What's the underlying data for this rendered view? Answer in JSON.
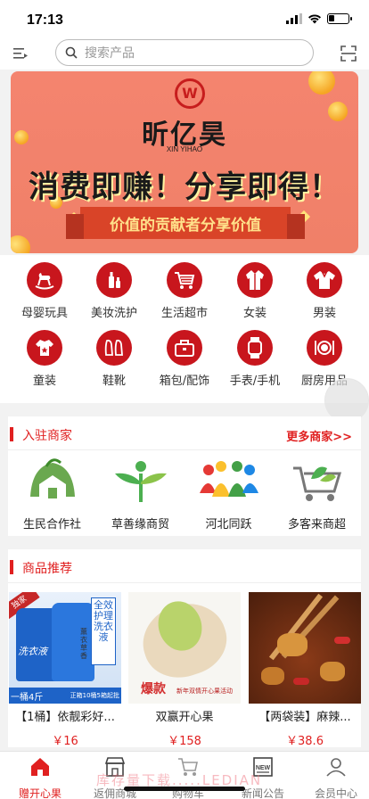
{
  "status_bar": {
    "time": "17:13",
    "battery_level": 0.3
  },
  "search": {
    "placeholder": "搜索产品"
  },
  "banner": {
    "brand_cn": "昕亿昊",
    "brand_en": "XIN YIHAO",
    "slogan": "消费即赚！分享即得！",
    "ribbon_text": "价值的贡献者分享价值"
  },
  "categories": [
    {
      "label": "母婴玩具",
      "icon": "rocking-horse-icon"
    },
    {
      "label": "美妆洗护",
      "icon": "cosmetics-icon"
    },
    {
      "label": "生活超市",
      "icon": "shopping-cart-icon"
    },
    {
      "label": "女装",
      "icon": "coat-icon"
    },
    {
      "label": "男装",
      "icon": "shirt-icon"
    },
    {
      "label": "童装",
      "icon": "kids-shirt-icon"
    },
    {
      "label": "鞋靴",
      "icon": "shoes-icon"
    },
    {
      "label": "箱包/配饰",
      "icon": "bag-icon"
    },
    {
      "label": "手表/手机",
      "icon": "watch-icon"
    },
    {
      "label": "厨房用品",
      "icon": "dish-icon"
    }
  ],
  "merchants": {
    "title": "入驻商家",
    "more": "更多商家>>",
    "items": [
      {
        "name": "生民合作社"
      },
      {
        "name": "草善缘商贸"
      },
      {
        "name": "河北同跃"
      },
      {
        "name": "多客来商超"
      }
    ]
  },
  "products": {
    "title": "商品推荐",
    "items": [
      {
        "name": "【1桶】依靓彩好...",
        "price": "￥16",
        "image_tag": "独家",
        "image_caption_left": "一桶4斤",
        "image_caption_right": "正箱10桶5箱起批",
        "image_side_text": "全效护理洗衣液",
        "image_side_sub": "薰衣草香",
        "bottle_label": "洗衣液"
      },
      {
        "name": "双赢开心果",
        "price": "￥158",
        "image_badge": "爆款",
        "image_promo": "新年双情开心果活动"
      },
      {
        "name": "【两袋装】麻辣...",
        "price": "￥38.6"
      }
    ]
  },
  "tabbar": [
    {
      "label": "赠开心果",
      "icon": "home-icon",
      "active": true
    },
    {
      "label": "返佣商城",
      "icon": "store-icon",
      "active": false
    },
    {
      "label": "购物车",
      "icon": "cart-icon",
      "active": false
    },
    {
      "label": "新闻公告",
      "icon": "news-icon",
      "active": false,
      "badge": "NEW"
    },
    {
      "label": "会员中心",
      "icon": "user-icon",
      "active": false
    }
  ],
  "watermark": "库存量下载.....LEDIAN",
  "colors": {
    "accent": "#e02020",
    "category_circle": "#c8161d",
    "banner_bg": "#f4846f"
  }
}
